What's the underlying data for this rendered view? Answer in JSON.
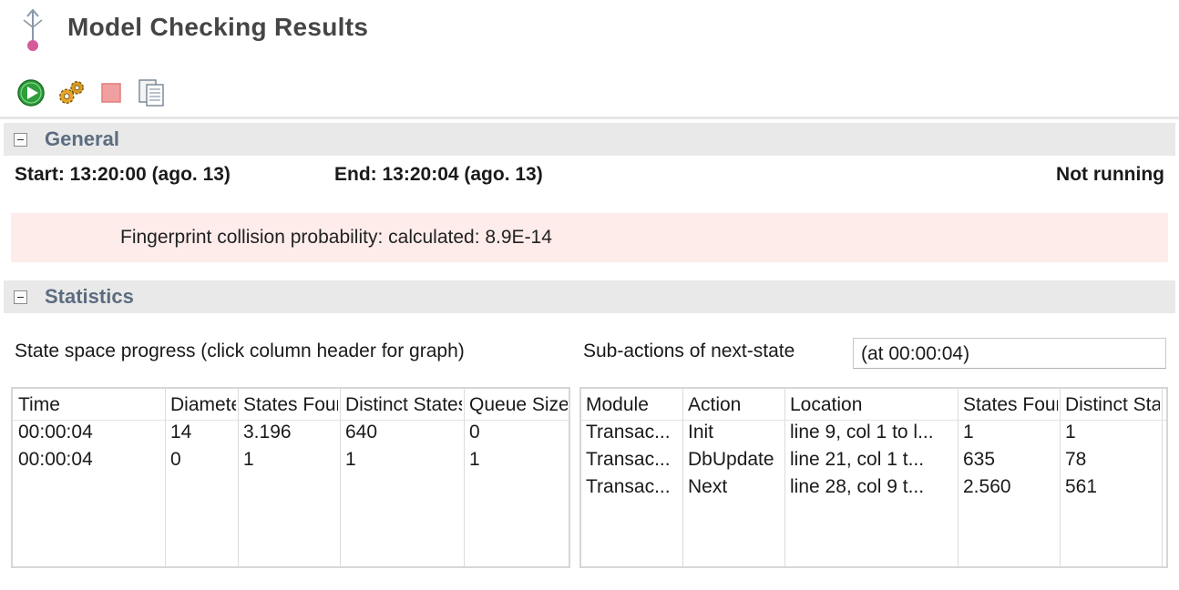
{
  "header": {
    "title": "Model Checking Results"
  },
  "toolbar": {
    "items": [
      {
        "name": "run-icon"
      },
      {
        "name": "settings-gears-icon"
      },
      {
        "name": "stop-icon"
      },
      {
        "name": "copy-document-icon"
      }
    ]
  },
  "general": {
    "title": "General",
    "start": "Start: 13:20:00 (ago. 13)",
    "end": "End: 13:20:04 (ago. 13)",
    "status": "Not running",
    "fingerprint": "Fingerprint collision probability: calculated: 8.9E-14"
  },
  "statistics": {
    "title": "Statistics",
    "progress_label": "State space progress (click column header for graph)",
    "subactions_label": "Sub-actions of next-state",
    "subactions_time": "(at 00:00:04)",
    "progress_table": {
      "headers": [
        "Time",
        "Diameter",
        "States Found",
        "Distinct States",
        "Queue Size"
      ],
      "rows": [
        [
          "00:00:04",
          "14",
          "3.196",
          "640",
          "0"
        ],
        [
          "00:00:04",
          "0",
          "1",
          "1",
          "1"
        ]
      ]
    },
    "subactions_table": {
      "headers": [
        "Module",
        "Action",
        "Location",
        "States Found",
        "Distinct States"
      ],
      "rows": [
        [
          "Transac...",
          "Init",
          "line 9, col 1 to l...",
          "1",
          "1"
        ],
        [
          "Transac...",
          "DbUpdate",
          "line 21, col 1 t...",
          "635",
          "78"
        ],
        [
          "Transac...",
          "Next",
          "line 28, col 9 t...",
          "2.560",
          "561"
        ]
      ]
    }
  },
  "colors": {
    "section_header_bg": "#e9e9e9",
    "section_title": "#5c6c80",
    "warning_bg": "#fdecea",
    "run_green": "#2e9e3a",
    "stop_red": "#f0a0a0",
    "model_icon_pink": "#d65a9a"
  }
}
